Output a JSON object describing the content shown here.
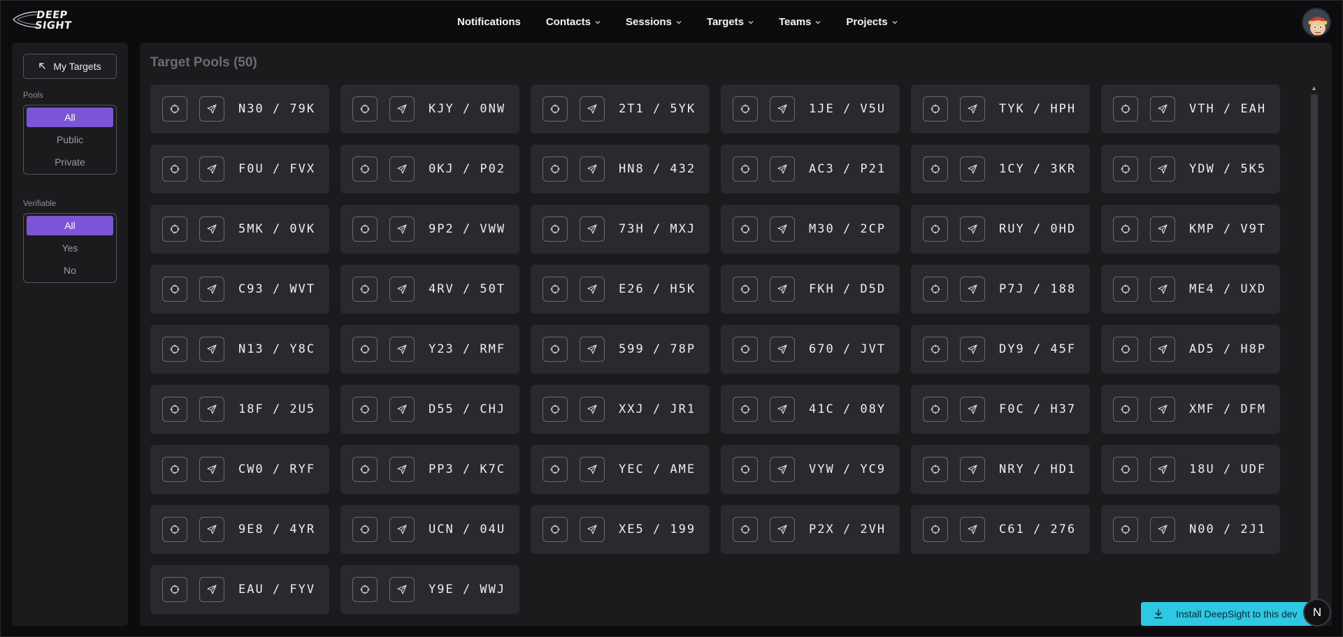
{
  "logo": {
    "text": "DEEP\nSIGHT"
  },
  "nav": [
    {
      "label": "Notifications",
      "has_dropdown": false
    },
    {
      "label": "Contacts",
      "has_dropdown": true
    },
    {
      "label": "Sessions",
      "has_dropdown": true
    },
    {
      "label": "Targets",
      "has_dropdown": true
    },
    {
      "label": "Teams",
      "has_dropdown": true
    },
    {
      "label": "Projects",
      "has_dropdown": true
    }
  ],
  "sidebar": {
    "my_targets_label": "My Targets",
    "pools_label": "Pools",
    "pools_options": [
      "All",
      "Public",
      "Private"
    ],
    "pools_selected": "All",
    "verifiable_label": "Verifiable",
    "verifiable_options": [
      "All",
      "Yes",
      "No"
    ],
    "verifiable_selected": "All"
  },
  "main": {
    "title": "Target Pools (50)",
    "pools": [
      "N30 / 79K",
      "KJY / 0NW",
      "2T1 / 5YK",
      "1JE / V5U",
      "TYK / HPH",
      "VTH / EAH",
      "F0U / FVX",
      "0KJ / P02",
      "HN8 / 432",
      "AC3 / P21",
      "1CY / 3KR",
      "YDW / 5K5",
      "5MK / 0VK",
      "9P2 / VWW",
      "73H / MXJ",
      "M30 / 2CP",
      "RUY / 0HD",
      "KMP / V9T",
      "C93 / WVT",
      "4RV / 50T",
      "E26 / H5K",
      "FKH / D5D",
      "P7J / 188",
      "ME4 / UXD",
      "N13 / Y8C",
      "Y23 / RMF",
      "599 / 78P",
      "670 / JVT",
      "DY9 / 45F",
      "AD5 / H8P",
      "18F / 2U5",
      "D55 / CHJ",
      "XXJ / JR1",
      "41C / 08Y",
      "F0C / H37",
      "XMF / DFM",
      "CW0 / RYF",
      "PP3 / K7C",
      "YEC / AME",
      "VYW / YC9",
      "NRY / HD1",
      "18U / UDF",
      "9E8 / 4YR",
      "UCN / 04U",
      "XE5 / 199",
      "P2X / 2VH",
      "C61 / 276",
      "N00 / 2J1",
      "EAU / FYV",
      "Y9E / WWJ"
    ],
    "card_icons": [
      "crosshair-icon",
      "send-icon"
    ]
  },
  "install_banner": {
    "label": "Install DeepSight to this dev"
  },
  "assistant_badge": {
    "label": "N"
  },
  "colors": {
    "accent": "#7c55d6",
    "banner": "#2ec8e2",
    "card": "#2a2a2e",
    "panel": "#1b1b1e"
  }
}
